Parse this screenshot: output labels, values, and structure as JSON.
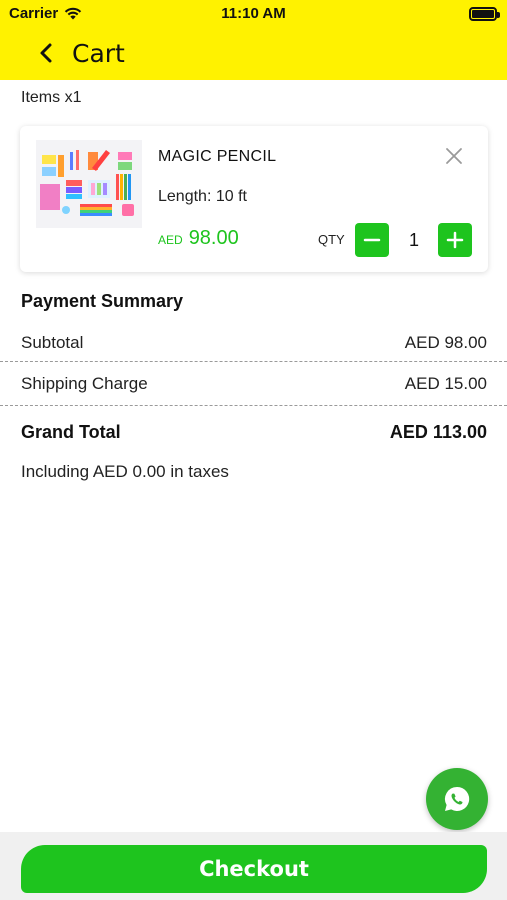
{
  "status_bar": {
    "carrier": "Carrier",
    "time": "11:10 AM"
  },
  "nav": {
    "title": "Cart"
  },
  "cart": {
    "items_count": "Items x1",
    "item": {
      "name": "MAGIC PENCIL",
      "variant": "Length: 10 ft",
      "currency": "AED",
      "price": "98.00",
      "qty_label": "QTY",
      "qty": "1"
    }
  },
  "summary": {
    "title": "Payment Summary",
    "subtotal_label": "Subtotal",
    "subtotal_value": "AED 98.00",
    "shipping_label": "Shipping Charge",
    "shipping_value": "AED 15.00",
    "total_label": "Grand Total",
    "total_value": "AED 113.00",
    "tax_note": "Including AED 0.00 in taxes"
  },
  "checkout_label": "Checkout",
  "colors": {
    "header": "#fff200",
    "accent_green": "#1ec41e",
    "whatsapp": "#34b233"
  },
  "icons": [
    "wifi-icon",
    "battery-icon",
    "back-chevron-icon",
    "close-icon",
    "minus-icon",
    "plus-icon",
    "whatsapp-icon"
  ]
}
